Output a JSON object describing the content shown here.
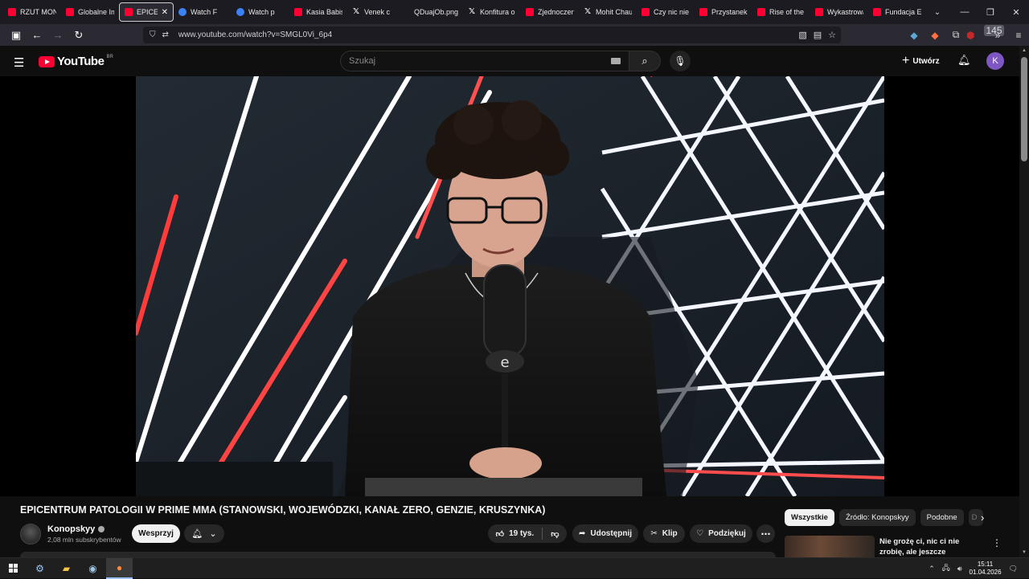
{
  "browser": {
    "tabs": [
      {
        "label": "RZUT MONETY",
        "icon": "yt",
        "active": false
      },
      {
        "label": "Globalne Imperium",
        "icon": "yt",
        "active": false
      },
      {
        "label": "EPICE",
        "icon": "yt",
        "active": true
      },
      {
        "label": "Watch F",
        "icon": "blue",
        "active": false
      },
      {
        "label": "Watch p",
        "icon": "blue",
        "active": false
      },
      {
        "label": "Kasia Babis",
        "icon": "yt",
        "active": false
      },
      {
        "label": "Venek c",
        "icon": "x",
        "active": false
      },
      {
        "label": "QDuajOb.png (",
        "icon": "none",
        "active": false
      },
      {
        "label": "Konfitura o",
        "icon": "x",
        "active": false
      },
      {
        "label": "Zjednoczeni",
        "icon": "yt",
        "active": false
      },
      {
        "label": "Mohit Chau",
        "icon": "x",
        "active": false
      },
      {
        "label": "Czy nic nie",
        "icon": "yt",
        "active": false
      },
      {
        "label": "Przystanek",
        "icon": "yt",
        "active": false
      },
      {
        "label": "Rise of the",
        "icon": "yt",
        "active": false
      },
      {
        "label": "Wykastrowa",
        "icon": "yt",
        "active": false
      },
      {
        "label": "Fundacja EC",
        "icon": "yt",
        "active": false
      }
    ],
    "url": "www.youtube.com/watch?v=SMGL0Vi_6p4",
    "extension_badge": "145"
  },
  "youtube": {
    "logo_text": "YouTube",
    "country_code": "BR",
    "search_placeholder": "Szukaj",
    "create_label": "Utwórz",
    "avatar_letter": "K"
  },
  "video": {
    "title": "EPICENTRUM PATOLOGII W PRIME MMA (STANOWSKI, WOJEWÓDZKI, KANAŁ ZERO, GENZIE, KRUSZYNKA)",
    "channel": "Konopskyy",
    "subscribers": "2,08 mln subskrybentów",
    "join_label": "Wesprzyj",
    "likes": "19 tys.",
    "share_label": "Udostępnij",
    "clip_label": "Klip",
    "thanks_label": "Podziękuj"
  },
  "sidebar": {
    "chips": [
      "Wszystkie",
      "Źródło: Konopskyy",
      "Podobne",
      "D"
    ],
    "recommendation_title": "Nie grożę ci, nic ci nie zrobię, ale jeszcze zobaczysz w ..."
  },
  "taskbar": {
    "time": "15:11",
    "date": "01.04.2026"
  }
}
